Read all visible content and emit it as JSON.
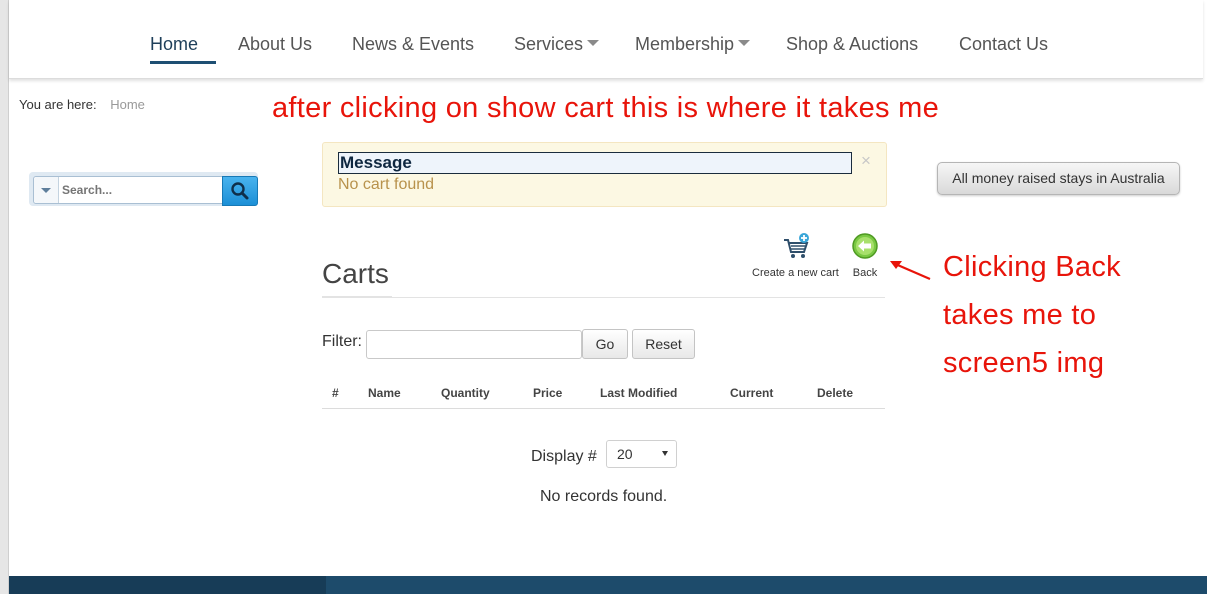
{
  "nav": {
    "items": [
      {
        "label": "Home",
        "active": true,
        "dropdown": false
      },
      {
        "label": "About Us",
        "active": false,
        "dropdown": false
      },
      {
        "label": "News & Events",
        "active": false,
        "dropdown": false
      },
      {
        "label": "Services",
        "active": false,
        "dropdown": true
      },
      {
        "label": "Membership",
        "active": false,
        "dropdown": true
      },
      {
        "label": "Shop & Auctions",
        "active": false,
        "dropdown": false
      },
      {
        "label": "Contact Us",
        "active": false,
        "dropdown": false
      }
    ]
  },
  "breadcrumb": {
    "prefix": "You are here:",
    "crumb": "Home"
  },
  "annotations": {
    "top": "after clicking on show cart this is where it takes me",
    "right": [
      "Clicking Back",
      "takes me to",
      "screen5 img"
    ]
  },
  "search": {
    "placeholder": "Search...",
    "icon": "magnifier-icon"
  },
  "message": {
    "title": "Message",
    "text": "No cart found",
    "close": "×"
  },
  "sidebar_button": {
    "label": "All money raised stays in Australia"
  },
  "carts": {
    "title": "Carts",
    "toolbar": {
      "new_label": "Create a new cart",
      "back_label": "Back"
    },
    "filter_label": "Filter:",
    "go_label": "Go",
    "reset_label": "Reset",
    "columns": [
      "#",
      "Name",
      "Quantity",
      "Price",
      "Last Modified",
      "Current",
      "Delete"
    ],
    "display_label": "Display #",
    "display_value": "20",
    "empty_text": "No records found."
  },
  "colors": {
    "accent": "#1e4f73",
    "annotation": "#e8140a",
    "message_bg": "#fcf8e3"
  }
}
